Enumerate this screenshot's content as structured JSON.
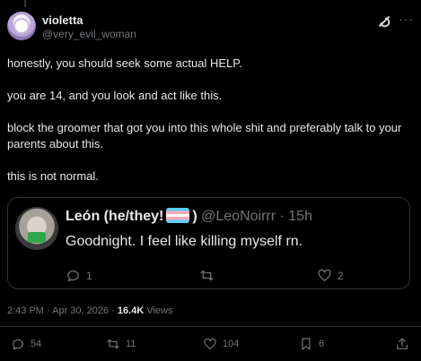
{
  "post": {
    "author_name": "violetta",
    "author_handle": "@very_evil_woman",
    "paragraphs": [
      "honestly, you should seek some actual HELP.",
      "you are 14, and you look and act like this.",
      "block the groomer that got you into this whole shit and preferably talk to your parents about this.",
      "this is not normal."
    ],
    "icons": [
      "grok-icon",
      "more-icon"
    ],
    "more_label": "···"
  },
  "quote": {
    "author_name": "León (he/they!",
    "author_suffix": ")",
    "author_handle": "@LeoNoirrr · 15h",
    "text": "Goodnight. I feel like killing myself rn.",
    "reply_count": "1",
    "like_count": "2"
  },
  "meta": {
    "timestamp": "2:43 PM · Apr 30, 2026 · ",
    "views_count": "16.4K",
    "views_label": " Views"
  },
  "actions": {
    "replies": "54",
    "reposts": "11",
    "likes": "104",
    "bookmarks": "6"
  }
}
